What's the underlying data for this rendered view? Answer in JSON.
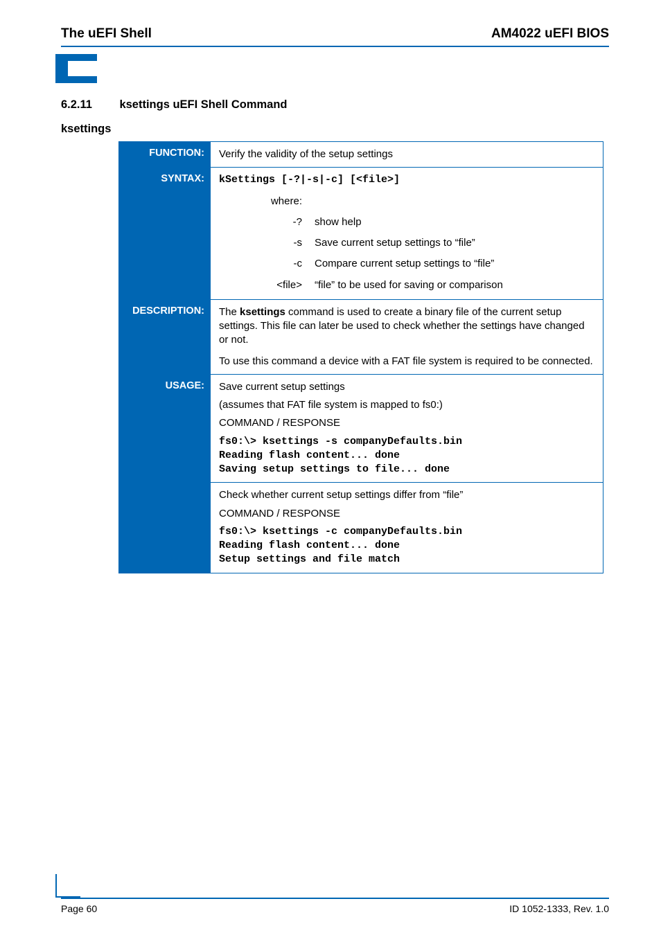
{
  "header": {
    "left": "The uEFI Shell",
    "right": "AM4022 uEFI BIOS"
  },
  "section": {
    "number": "6.2.11",
    "title": "ksettings uEFI Shell Command"
  },
  "subheading": "ksettings",
  "rows": {
    "function": {
      "label": "FUNCTION:",
      "text": "Verify the validity of the setup settings"
    },
    "syntax": {
      "label": "SYNTAX:",
      "code": "kSettings [-?|-s|-c] [<file>]",
      "where_label": "where:",
      "options": [
        {
          "key": "-?",
          "desc": "show help"
        },
        {
          "key": "-s",
          "desc": "Save current setup settings to “file”"
        },
        {
          "key": "-c",
          "desc": "Compare current setup settings to “file”"
        },
        {
          "key": "<file>",
          "desc": "“file” to be used for saving or comparison"
        }
      ]
    },
    "description": {
      "label": "DESCRIPTION:",
      "para1_pre": "The ",
      "para1_bold": "ksettings",
      "para1_post": " command is used to create a binary file of the current setup settings. This file can later be used to check whether the settings have changed or not.",
      "para2": "To use this command a device with a FAT file system is required to be connected."
    },
    "usage": {
      "label": "USAGE:",
      "part1": {
        "line1": "Save current setup settings",
        "line2": "(assumes that FAT file system is mapped to fs0:)",
        "line3": "COMMAND / RESPONSE",
        "code": "fs0:\\> ksettings -s companyDefaults.bin\nReading flash content... done\nSaving setup settings to file... done"
      },
      "part2": {
        "line1": "Check whether current setup settings differ from “file”",
        "line2": "COMMAND / RESPONSE",
        "code": "fs0:\\> ksettings -c companyDefaults.bin\nReading flash content... done\nSetup settings and file match"
      }
    }
  },
  "footer": {
    "left": "Page 60",
    "right": "ID 1052-1333, Rev. 1.0"
  }
}
